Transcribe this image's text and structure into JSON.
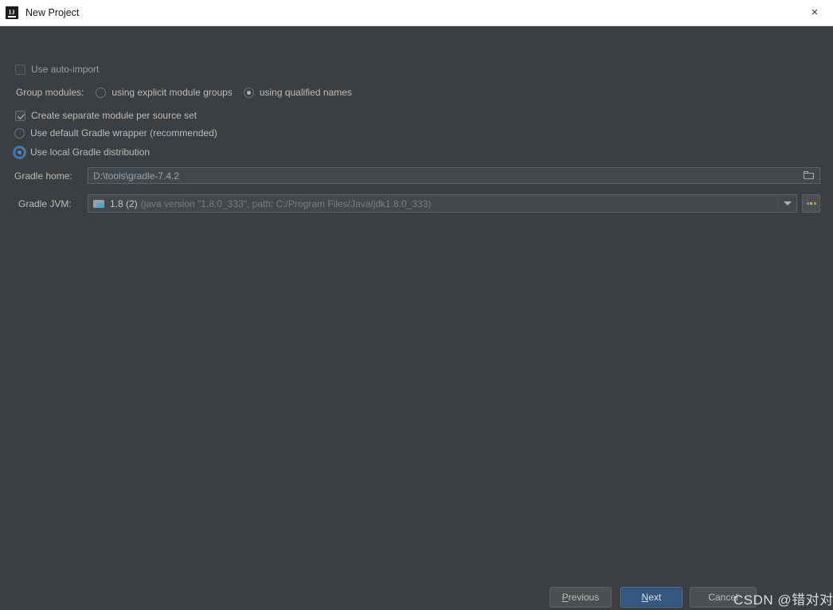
{
  "window": {
    "title": "New Project",
    "app_icon": "IJ",
    "close_icon": "×"
  },
  "form": {
    "auto_import": {
      "label": "Use auto-import",
      "checked": false
    },
    "group_modules": {
      "label": "Group modules:",
      "options": [
        {
          "label": "using explicit module groups",
          "selected": false
        },
        {
          "label": "using qualified names",
          "selected": true
        }
      ]
    },
    "separate_module": {
      "label": "Create separate module per source set",
      "checked": true
    },
    "gradle_wrapper": {
      "label": "Use default Gradle wrapper (recommended)",
      "selected": false
    },
    "local_distribution": {
      "label": "Use local Gradle distribution",
      "selected": true,
      "focused": true
    },
    "gradle_home": {
      "label": "Gradle home:",
      "value": "D:\\tools\\gradle-7.4.2",
      "browse_icon": "folder-icon"
    },
    "gradle_jvm": {
      "label": "Gradle JVM:",
      "value_main": "1.8 (2)",
      "value_detail": "(java version \"1.8.0_333\", path: C:/Program Files/Java/jdk1.8.0_333)",
      "dropdown_icon": "chevron-down-icon",
      "browse_label": "..."
    }
  },
  "footer": {
    "previous": {
      "prefix": "",
      "mnemonic": "P",
      "suffix": "revious"
    },
    "next": {
      "prefix": "",
      "mnemonic": "N",
      "suffix": "ext"
    },
    "cancel": {
      "label": "Cancel"
    }
  },
  "watermark": {
    "text": "CSDN @错对对"
  }
}
